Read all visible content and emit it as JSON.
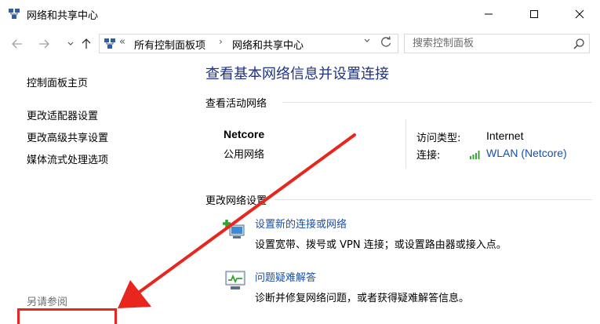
{
  "window": {
    "title": "网络和共享中心",
    "icon": "network-center-icon",
    "controls": [
      "minimize-icon",
      "maximize-icon",
      "close-icon"
    ]
  },
  "nav": {
    "back_icon": "arrow-left-icon",
    "forward_icon": "arrow-right-icon",
    "up_icon": "arrow-up-icon",
    "breadcrumb_prefix": "«",
    "breadcrumbs": [
      "所有控制面板项",
      "网络和共享中心"
    ],
    "separator": "›",
    "search_placeholder": "搜索控制面板"
  },
  "sidebar": {
    "items": [
      {
        "label": "控制面板主页"
      },
      {
        "label": "更改适配器设置"
      },
      {
        "label": "更改高级共享设置"
      },
      {
        "label": "媒体流式处理选项"
      }
    ],
    "see_also": "另请参阅"
  },
  "main": {
    "title": "查看基本网络信息并设置连接",
    "active_section": "查看活动网络",
    "network_name": "Netcore",
    "network_type": "公用网络",
    "access_type_label": "访问类型:",
    "access_type_value": "Internet",
    "connection_label": "连接:",
    "connection_value": "WLAN (Netcore)",
    "change_section": "更改网络设置",
    "setup_link": "设置新的连接或网络",
    "setup_desc": "设置宽带、拨号或 VPN 连接；或设置路由器或接入点。",
    "trouble_link": "问题疑难解答",
    "trouble_desc": "诊断并修复网络问题，或者获得疑难解答信息。"
  },
  "colors": {
    "accent_title": "#1e3287",
    "link": "#1a4fa8",
    "annotation": "#e8261e",
    "muted": "#6d6d6d"
  }
}
